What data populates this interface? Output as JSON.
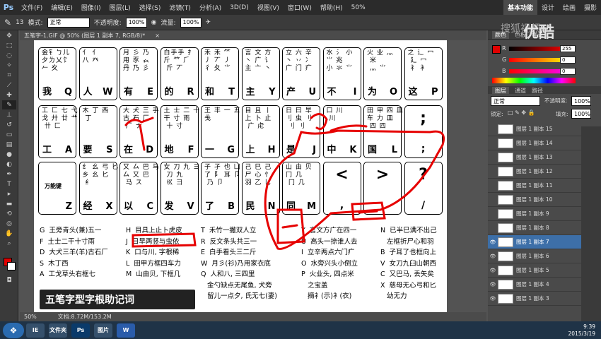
{
  "app": {
    "logo": "Ps",
    "menus": [
      "文件(F)",
      "编辑(E)",
      "图像(I)",
      "图层(L)",
      "选择(S)",
      "滤镜(T)",
      "分析(A)",
      "3D(D)",
      "视图(V)",
      "窗口(W)",
      "帮助(H)"
    ],
    "zoom": "50%",
    "workspaces": [
      "基本功能",
      "设计",
      "绘画",
      "摄影"
    ]
  },
  "options": {
    "mode_label": "模式:",
    "mode_value": "正常",
    "opacity_label": "不透明度:",
    "opacity_value": "100%",
    "flow_label": "流量:",
    "flow_value": "100%",
    "brush_size": "13"
  },
  "document": {
    "tab_title": "五笔字-1.GIF @ 50% (图层 1 副本 7, RGB/8)*",
    "zoom": "50%",
    "status": "文档:8.72M/153.2M"
  },
  "keys": {
    "r1": [
      {
        "roots": "金钅ㄅ儿\n夕ㄌ乂饣\n𠂉 夊",
        "big": "我",
        "letter": "Q"
      },
      {
        "roots": "亻 亻\n八 癶",
        "big": "人",
        "letter": "W"
      },
      {
        "roots": "月 彡 乃\n用 豕 𧘇\n丹 乃 彡",
        "big": "有",
        "letter": "E"
      },
      {
        "roots": "白手手 ⺘\n斤 ⺮ ⺁\n 斤 丆",
        "big": "的",
        "letter": "R"
      },
      {
        "roots": "禾 禾 ⺮\n丿 丆 丿\n彳 夂 ⺌",
        "big": "和",
        "letter": "T"
      },
      {
        "roots": "言 文 方\n丶 广 讠\n主 亠 丶",
        "big": "主",
        "letter": "Y"
      },
      {
        "roots": "立 六 辛\n丶 丷 冫\n广 门 疒",
        "big": "产",
        "letter": "U"
      },
      {
        "roots": "水 氵 小\n⺌ 兆\n小 氺 ⺌",
        "big": "不",
        "letter": "I"
      },
      {
        "roots": "火 业 灬\n 米\n 灬 ⺌",
        "big": "为",
        "letter": "O"
      },
      {
        "roots": "之 辶 冖\n 廴 冖\n 礻 衤",
        "big": "这",
        "letter": "P"
      }
    ],
    "r2": [
      {
        "roots": "工 匚 七 弋\n戈 廾 廿 艹\n 卄 匚",
        "big": "工",
        "letter": "A"
      },
      {
        "roots": "木 丁 西\n 丁",
        "big": "要",
        "letter": "S"
      },
      {
        "roots": "大 犬 三 手\n古 石 厂\n 厂 ナ",
        "big": "在",
        "letter": "D"
      },
      {
        "roots": "土 士 二 十\n干 寸 雨\n 十 寸",
        "big": "地",
        "letter": "F"
      },
      {
        "roots": "王 丰 一 五\n戋",
        "big": "一",
        "letter": "G"
      },
      {
        "roots": "目 且 丨\n上 卜 止\n 广 虍",
        "big": "上",
        "letter": "H"
      },
      {
        "roots": "日 曰 早\n刂 虫 刂\n 刂 刂",
        "big": "是",
        "letter": "J"
      },
      {
        "roots": "口 川\n 川",
        "big": "中",
        "letter": "K"
      },
      {
        "roots": "田 甲 四 皿\n车 力 皿\n 四 四",
        "big": "国",
        "letter": "L"
      },
      {
        "symtop": ";",
        "symbot": ";"
      }
    ],
    "r3": [
      {
        "label": "万能键",
        "letter": "Z"
      },
      {
        "roots": "纟 幺 弓 匕\n乡 幺 匕\n 纟",
        "big": "经",
        "letter": "X"
      },
      {
        "roots": "又 厶 巴 马\n厶 又 巴\n 马 ス",
        "big": "以",
        "letter": "C"
      },
      {
        "roots": "女 刀 九 ヨ\n 刀 九\n 巛 彐",
        "big": "发",
        "letter": "V"
      },
      {
        "roots": "子 孑 也 凵\n了 阝 耳 卩\n 乃 卩",
        "big": "了",
        "letter": "B"
      },
      {
        "roots": "己 巳 己\n尸 心 忄\n羽 乙 乚",
        "big": "民",
        "letter": "N"
      },
      {
        "roots": "山 由 贝\n冂 几 \n 冂 几",
        "big": "同",
        "letter": "M"
      },
      {
        "symtop": "<",
        "symbot": ","
      },
      {
        "symtop": ">",
        "symbot": "."
      },
      {
        "symtop": "?",
        "symbot": "/"
      }
    ]
  },
  "mnemonics": [
    [
      "G  王旁青头(兼)五一",
      "F  土士二干十寸雨",
      "D  大犬三羊(羊)古石厂",
      "S  木丁西",
      "A  工戈草头右框七"
    ],
    [
      "H  目具上止卜虎皮",
      "J  日早两竖与虫依",
      "K  口与川, 字根稀",
      "L  田甲方框四车力",
      "M  山由贝, 下框几"
    ],
    [
      "T  禾竹一撇双人立",
      "R  反文条头共三一",
      "E  白手看头三二斤",
      "W  月彡(衫)乃用家衣底",
      "Q  人和八, 三四里",
      "   金勺缺点无尾鱼, 犬旁",
      "   留儿一点夕, 氏无七(妻)"
    ],
    [
      "Y  言文方广在四一",
      "U  高头一捺谁人去",
      "I  立辛两点六门疒",
      "O  水旁兴头小倒立",
      "P  火业头, 四点米",
      "   之宝盖",
      "   摘礻(示)衤(衣)"
    ],
    [
      "N  已半巳满不出己",
      "   左框折尸心和羽",
      "B  子耳了也框向上",
      "V  女刀九臼山朝西",
      "C  又巴马, 丢矢矣",
      "X  慈母无心弓和匕",
      "   幼无力"
    ]
  ],
  "doc_title_text": "五笔字型字根助记词",
  "panels": {
    "color_tabs": [
      "颜色",
      "色板",
      "样式"
    ],
    "r_label": "R",
    "r_value": "255",
    "g_label": "G",
    "g_value": "0",
    "b_label": "B",
    "b_value": "0",
    "layer_tabs": [
      "图层",
      "通道",
      "路径"
    ],
    "blend_mode": "正常",
    "opacity_label": "不透明度:",
    "opacity_value": "100%",
    "lock_label": "锁定:",
    "fill_label": "填充:",
    "fill_value": "100%",
    "layers": [
      "图层 1 副本 15",
      "图层 1 副本 14",
      "图层 1 副本 13",
      "图层 1 副本 12",
      "图层 1 副本 11",
      "图层 1 副本 10",
      "图层 1 副本 9",
      "图层 1 副本 8",
      "图层 1 副本 7",
      "图层 1 副本 6",
      "图层 1 副本 5",
      "图层 1 副本 4",
      "图层 1 副本 3"
    ],
    "selected_layer": 8
  },
  "watermark": "优酷",
  "watermark_small": "搜狐视频",
  "taskbar": {
    "apps": [
      "IE",
      "文件夹",
      "Ps",
      "图片",
      "W"
    ],
    "time": "9:39",
    "date": "2015/3/19"
  },
  "accent": {
    "fg": "#e00000",
    "bg": "#ffffff",
    "selection": "#3d6fa8",
    "annotation": "#e60000"
  }
}
